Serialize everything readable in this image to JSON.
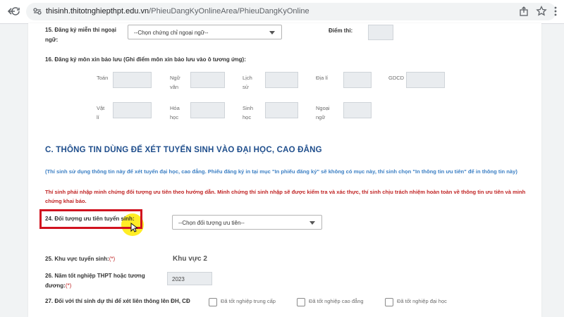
{
  "browser": {
    "url_domain": "thisinh.thitotnghiepthpt.edu.vn",
    "url_path": "/PhieuDangKyOnlineArea/PhieuDangKyOnline",
    "icons": [
      "back-icon",
      "reload-icon",
      "site-info-icon",
      "share-icon",
      "bookmark-star-icon",
      "more-menu-icon"
    ]
  },
  "form": {
    "q15": {
      "label_line1": "15. Đăng ký miễn thi ngoại",
      "label_line2": "ngữ:",
      "select_value": "--Chọn chứng chỉ ngoại ngữ--",
      "score_label": "Điểm thi:"
    },
    "q16": {
      "label": "16. Đăng ký môn xin bảo lưu (Ghi điểm môn xin bảo lưu vào ô tương ứng):",
      "row1": [
        {
          "line1": "Toán",
          "line2": ""
        },
        {
          "line1": "Ngữ",
          "line2": "văn"
        },
        {
          "line1": "Lịch",
          "line2": "sử"
        },
        {
          "line1": "Địa lí",
          "line2": ""
        },
        {
          "line1": "GDCD",
          "line2": ""
        }
      ],
      "row2": [
        {
          "line1": "Vật",
          "line2": "lí"
        },
        {
          "line1": "Hóa",
          "line2": "học"
        },
        {
          "line1": "Sinh",
          "line2": "học"
        },
        {
          "line1": "Ngoại",
          "line2": "ngữ"
        }
      ]
    },
    "section_c": {
      "heading": "C. THÔNG TIN DÙNG ĐỂ XÉT TUYỂN SINH VÀO ĐẠI HỌC, CAO ĐẲNG",
      "info_blue": "(Thí sinh sử dụng thông tin này để xét tuyển đại học, cao đẳng. Phiếu đăng ký in tại mục \"In phiếu đăng ký\" sẽ không có mục này, thí sinh chọn \"In thông tin ưu tiên\" để in thông tin này)",
      "info_red": "Thí sinh phải nhập minh chứng đối tượng ưu tiên theo hướng dẫn. Minh chứng thí sinh nhập sẽ được kiểm tra và xác thực, thí sinh chịu trách nhiệm hoàn toàn về thông tin ưu tiên và minh chứng khai báo."
    },
    "q24": {
      "label": "24. Đối tượng ưu tiên tuyển sinh:",
      "select_value": "--Chọn đối tượng ưu tiên--"
    },
    "q25": {
      "label": "25. Khu vực tuyển sinh:",
      "required": "(*)",
      "value": "Khu vực 2"
    },
    "q26": {
      "label_line1": "26. Năm tốt nghiệp THPT hoặc tương",
      "label_line2": "đương:",
      "required": "(*)",
      "value": "2023"
    },
    "q27": {
      "label": "27. Đối với thí sinh dự thi để xét liên thông lên ĐH, CĐ",
      "options": [
        "Đã tốt nghiệp trung cấp",
        "Đã tốt nghiệp cao đẳng",
        "Đã tốt nghiệp đại học"
      ]
    }
  },
  "colors": {
    "heading": "#1f4e8c",
    "info_blue": "#3b7fc4",
    "info_red": "#c02424",
    "highlight_frame": "#d1121f",
    "cursor_highlight": "#ffea00"
  }
}
